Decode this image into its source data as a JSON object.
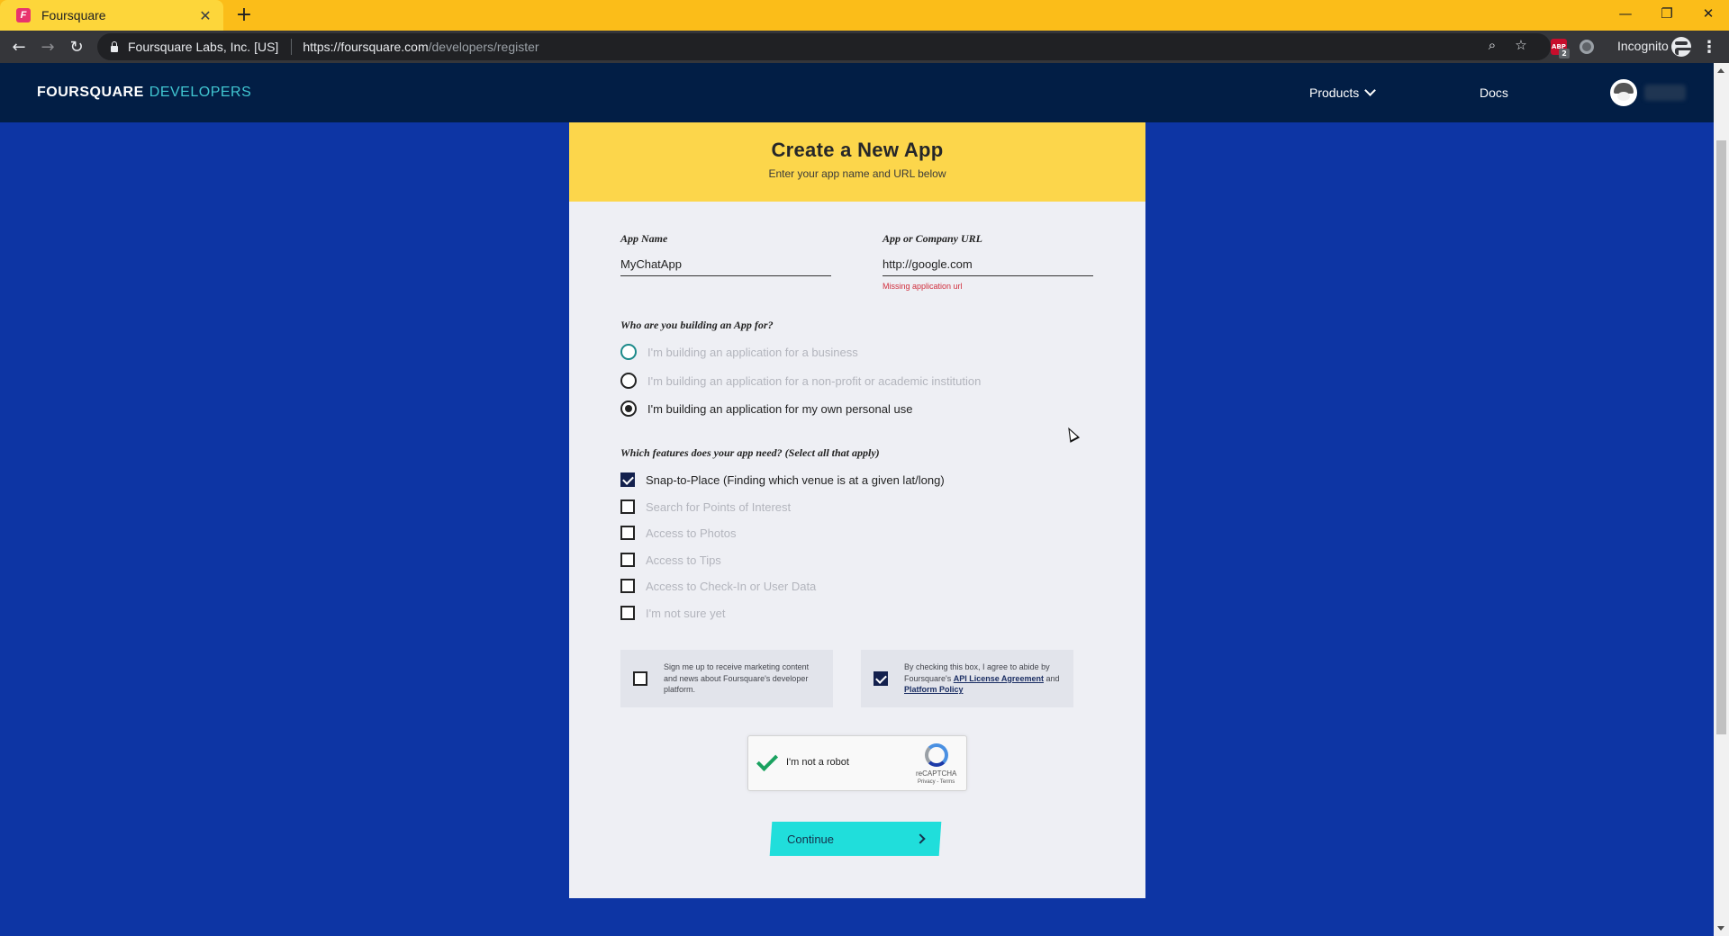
{
  "browser": {
    "tab_title": "Foursquare",
    "tab_favicon_letter": "F",
    "tab_close": "✕",
    "new_tab": "+",
    "window_controls": {
      "minimize": "—",
      "restore": "❐",
      "close": "✕"
    },
    "nav": {
      "back": "←",
      "forward": "→",
      "reload": "↻"
    },
    "ev_cert": "Foursquare Labs, Inc. [US]",
    "url_host": "https://foursquare.com",
    "url_path": "/developers/register",
    "zoom_icon": "search-icon",
    "bookmark_icon": "star-icon",
    "extensions": {
      "abp_label": "ABP",
      "abp_badge": "2"
    },
    "incognito_label": "Incognito",
    "menu": "⋮"
  },
  "site": {
    "brand_main": "FOURSQUARE",
    "brand_sub": "DEVELOPERS",
    "nav_products": "Products",
    "nav_docs": "Docs"
  },
  "form": {
    "title": "Create a New App",
    "subtitle": "Enter your app name and URL below",
    "app_name": {
      "label": "App Name",
      "value": "MyChatApp"
    },
    "app_url": {
      "label": "App or Company URL",
      "value": "http://google.com",
      "error": "Missing application url"
    },
    "audience": {
      "question": "Who are you building an App for?",
      "options": [
        {
          "label": "I'm building an application for a business",
          "checked": false
        },
        {
          "label": "I'm building an application for a non-profit or academic institution",
          "checked": false
        },
        {
          "label": "I'm building an application for my own personal use",
          "checked": true
        }
      ]
    },
    "features": {
      "question": "Which features does your app need? (Select all that apply)",
      "options": [
        {
          "label": "Snap-to-Place (Finding which venue is at a given lat/long)",
          "checked": true
        },
        {
          "label": "Search for Points of Interest",
          "checked": false
        },
        {
          "label": "Access to Photos",
          "checked": false
        },
        {
          "label": "Access to Tips",
          "checked": false
        },
        {
          "label": "Access to Check-In or User Data",
          "checked": false
        },
        {
          "label": "I'm not sure yet",
          "checked": false
        }
      ]
    },
    "marketing_consent": {
      "text": "Sign me up to receive marketing content and news about Foursquare's developer platform.",
      "checked": false
    },
    "terms_consent": {
      "prefix": "By checking this box, I agree to abide by Foursquare's ",
      "link1": "API License Agreement",
      "middle": " and ",
      "link2": "Platform Policy",
      "checked": true
    },
    "recaptcha": {
      "label": "I'm not a robot",
      "brand": "reCAPTCHA",
      "links": "Privacy - Terms",
      "verified": true
    },
    "continue_label": "Continue"
  },
  "colors": {
    "page_bg": "#0d35a4",
    "nav_bg": "#021e45",
    "header_yellow": "#fcd64b",
    "accent_teal": "#20dedb",
    "error_red": "#d12f3d",
    "chrome_yellow": "#fbbd19"
  }
}
